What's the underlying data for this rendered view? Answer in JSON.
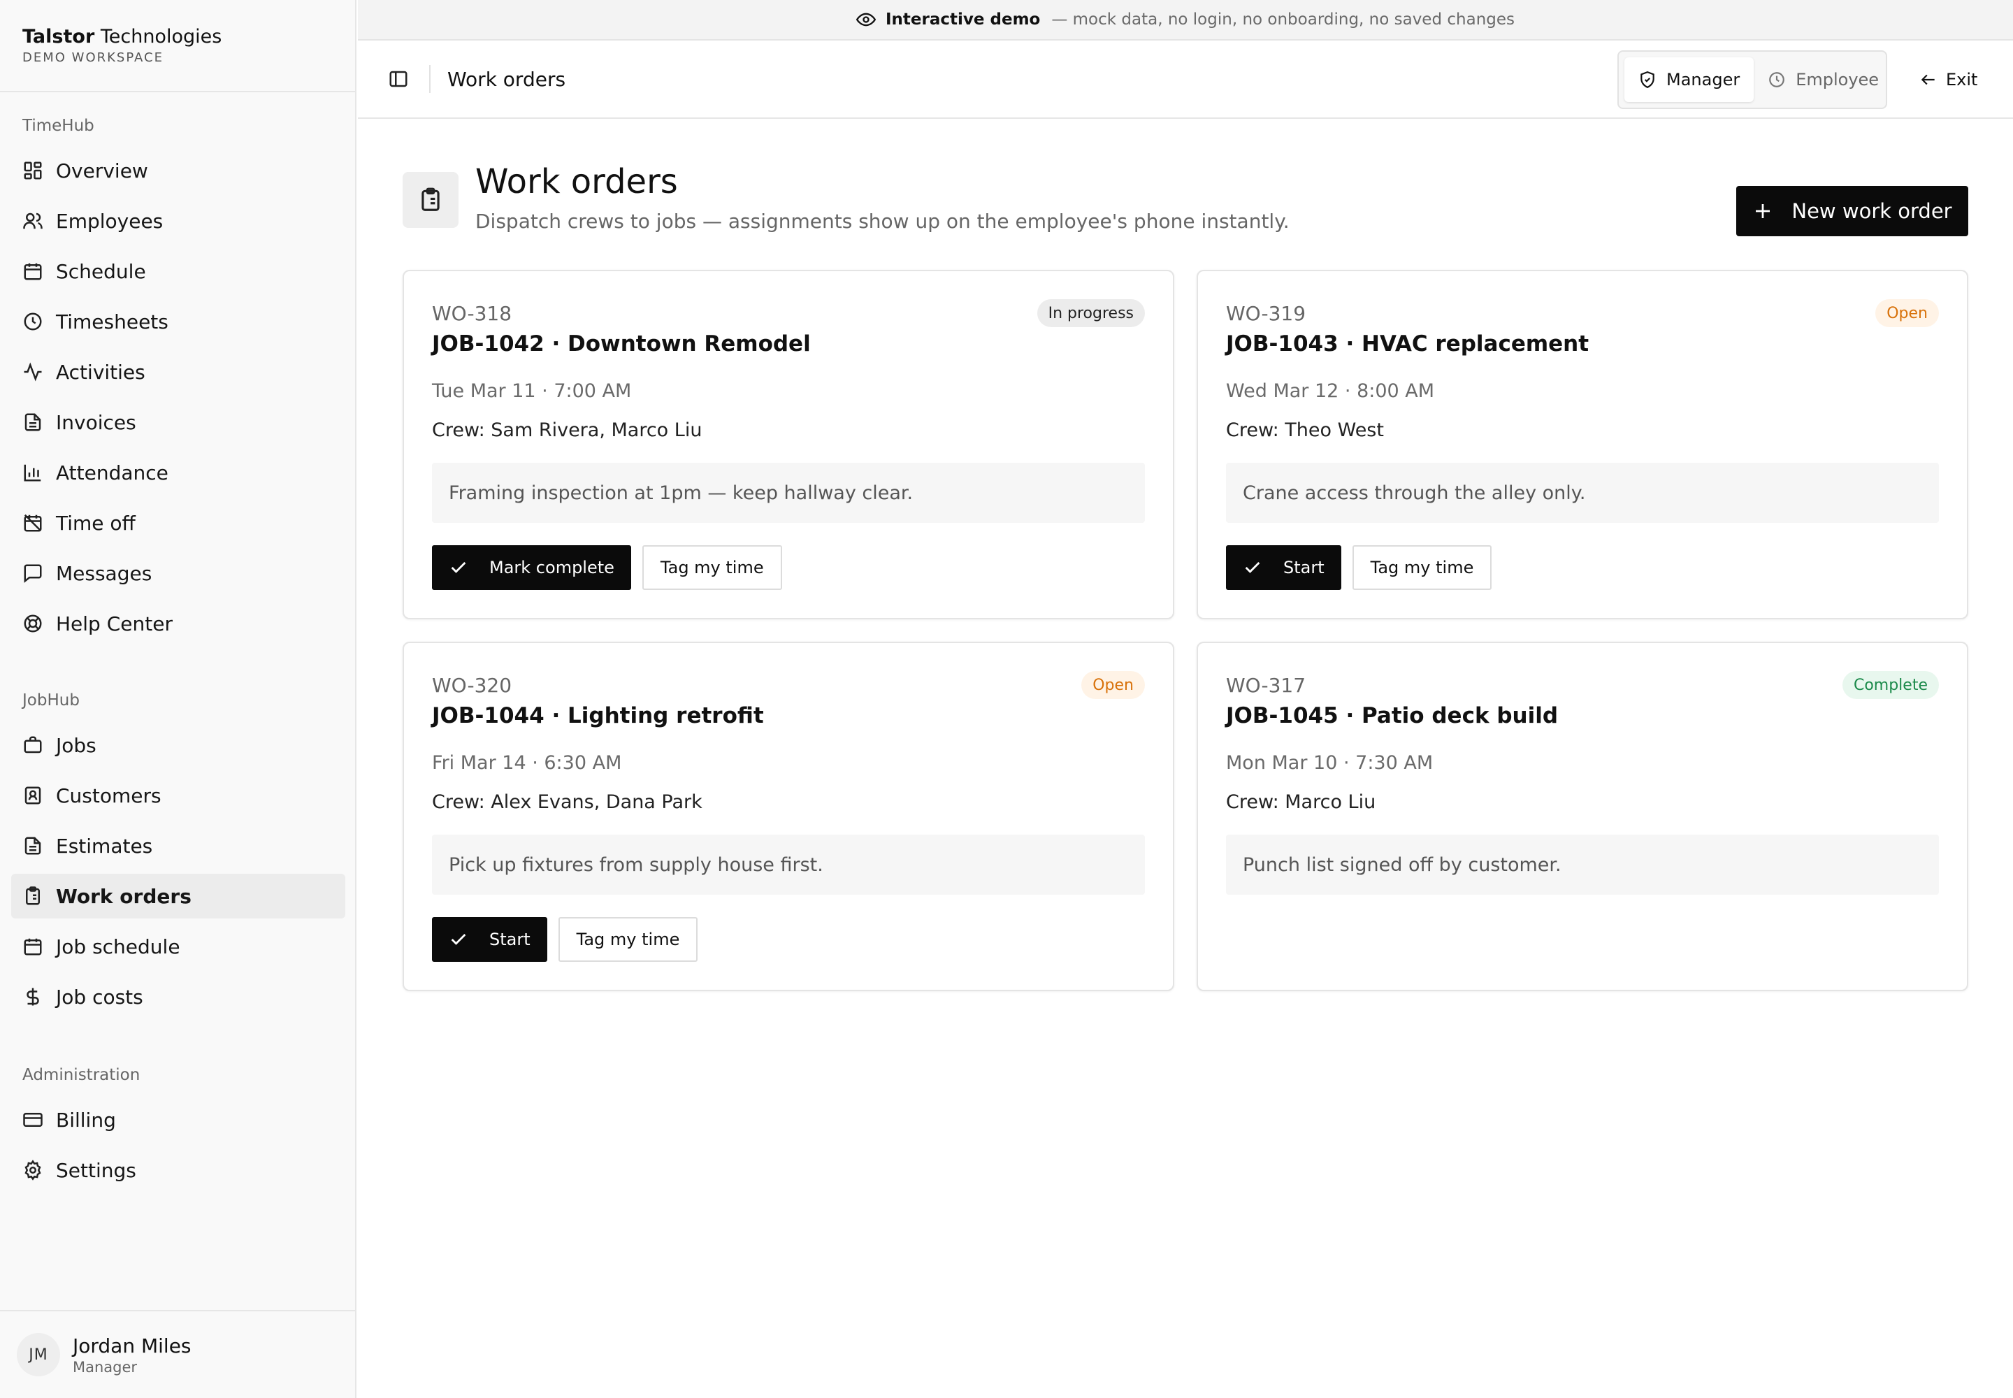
{
  "workspace": {
    "brand_bold": "Talstor",
    "brand_rest": " Technologies",
    "subtitle": "DEMO WORKSPACE"
  },
  "sidebar": {
    "sections": [
      {
        "heading": "TimeHub",
        "items": [
          {
            "label": "Overview",
            "icon": "dashboard-icon"
          },
          {
            "label": "Employees",
            "icon": "users-icon"
          },
          {
            "label": "Schedule",
            "icon": "calendar-icon"
          },
          {
            "label": "Timesheets",
            "icon": "clock-icon"
          },
          {
            "label": "Activities",
            "icon": "activity-icon"
          },
          {
            "label": "Invoices",
            "icon": "document-icon"
          },
          {
            "label": "Attendance",
            "icon": "bar-chart-icon"
          },
          {
            "label": "Time off",
            "icon": "calendar-off-icon"
          },
          {
            "label": "Messages",
            "icon": "message-icon"
          },
          {
            "label": "Help Center",
            "icon": "lifebuoy-icon"
          }
        ]
      },
      {
        "heading": "JobHub",
        "items": [
          {
            "label": "Jobs",
            "icon": "briefcase-icon"
          },
          {
            "label": "Customers",
            "icon": "contact-icon"
          },
          {
            "label": "Estimates",
            "icon": "document-icon"
          },
          {
            "label": "Work orders",
            "icon": "clipboard-icon",
            "active": true
          },
          {
            "label": "Job schedule",
            "icon": "calendar-icon"
          },
          {
            "label": "Job costs",
            "icon": "dollar-icon"
          }
        ]
      },
      {
        "heading": "Administration",
        "items": [
          {
            "label": "Billing",
            "icon": "credit-card-icon"
          },
          {
            "label": "Settings",
            "icon": "gear-icon"
          }
        ]
      }
    ]
  },
  "user": {
    "initials": "JM",
    "name": "Jordan Miles",
    "role": "Manager"
  },
  "banner": {
    "strong": "Interactive demo",
    "muted": "— mock data, no login, no onboarding, no saved changes",
    "icon": "eye-icon"
  },
  "header": {
    "title": "Work orders",
    "roles": {
      "manager": "Manager",
      "employee": "Employee"
    },
    "exit_label": "Exit"
  },
  "page": {
    "title": "Work orders",
    "subtitle": "Dispatch crews to jobs — assignments show up on the employee's phone instantly.",
    "new_button_label": "New work order"
  },
  "work_orders": [
    {
      "code": "WO-318",
      "title": "JOB-1042 · Downtown Remodel",
      "date": "Tue Mar 11 · 7:00 AM",
      "crew": "Crew: Sam Rivera, Marco Liu",
      "note": "Framing inspection at 1pm — keep hallway clear.",
      "status": "In progress",
      "primary_action": "Mark complete",
      "secondary_action": "Tag my time"
    },
    {
      "code": "WO-319",
      "title": "JOB-1043 · HVAC replacement",
      "date": "Wed Mar 12 · 8:00 AM",
      "crew": "Crew: Theo West",
      "note": "Crane access through the alley only.",
      "status": "Open",
      "primary_action": "Start",
      "secondary_action": "Tag my time"
    },
    {
      "code": "WO-320",
      "title": "JOB-1044 · Lighting retrofit",
      "date": "Fri Mar 14 · 6:30 AM",
      "crew": "Crew: Alex Evans, Dana Park",
      "note": "Pick up fixtures from supply house first.",
      "status": "Open",
      "primary_action": "Start",
      "secondary_action": "Tag my time"
    },
    {
      "code": "WO-317",
      "title": "JOB-1045 · Patio deck build",
      "date": "Mon Mar 10 · 7:30 AM",
      "crew": "Crew: Marco Liu",
      "note": "Punch list signed off by customer.",
      "status": "Complete"
    }
  ],
  "colors": {
    "primary": "#0b0b0b",
    "open_status": "#d8720b",
    "complete_status": "#1b8a4a",
    "sidebar_bg": "#f9f9f9",
    "active_item_bg": "#ececec"
  }
}
